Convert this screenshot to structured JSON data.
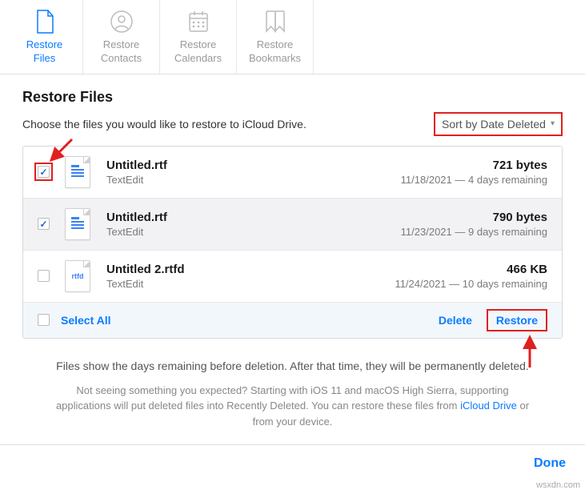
{
  "toolbar": {
    "items": [
      {
        "label1": "Restore",
        "label2": "Files"
      },
      {
        "label1": "Restore",
        "label2": "Contacts"
      },
      {
        "label1": "Restore",
        "label2": "Calendars"
      },
      {
        "label1": "Restore",
        "label2": "Bookmarks"
      }
    ]
  },
  "page": {
    "title": "Restore Files",
    "subtitle": "Choose the files you would like to restore to iCloud Drive.",
    "sort_label": "Sort by Date Deleted"
  },
  "files": [
    {
      "name": "Untitled.rtf",
      "app": "TextEdit",
      "size": "721 bytes",
      "date": "11/18/2021 — 4 days remaining",
      "checked": true,
      "ext": "rtf"
    },
    {
      "name": "Untitled.rtf",
      "app": "TextEdit",
      "size": "790 bytes",
      "date": "11/23/2021 — 9 days remaining",
      "checked": true,
      "ext": "rtf"
    },
    {
      "name": "Untitled 2.rtfd",
      "app": "TextEdit",
      "size": "466 KB",
      "date": "11/24/2021 — 10 days remaining",
      "checked": false,
      "ext": "rtfd"
    }
  ],
  "actions": {
    "select_all": "Select All",
    "delete": "Delete",
    "restore": "Restore"
  },
  "help": {
    "line1": "Files show the days remaining before deletion. After that time, they will be permanently deleted.",
    "notice_a": "Not seeing something you expected? Starting with iOS 11 and macOS High Sierra, supporting applications will put deleted files into Recently Deleted. You can restore these files from ",
    "link": "iCloud Drive",
    "notice_b": " or from your device."
  },
  "footer": {
    "done": "Done"
  },
  "watermark": "wsxdn.com"
}
